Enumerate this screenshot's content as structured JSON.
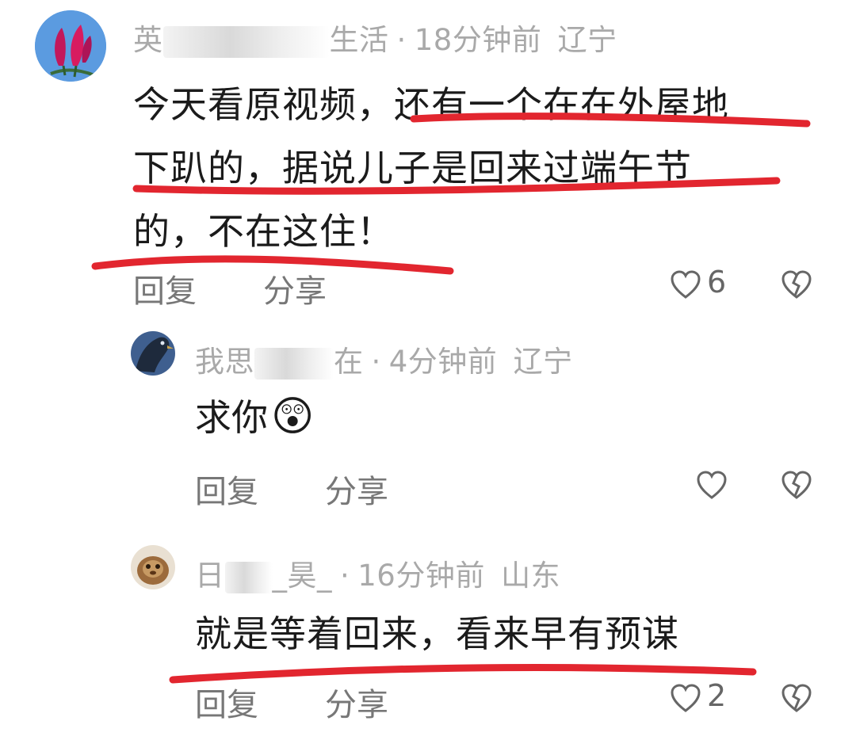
{
  "colors": {
    "underline": "#e2262f",
    "meta": "#a9a9a9",
    "text": "#1b1b1b",
    "action": "#777777"
  },
  "comments": [
    {
      "user_visible_start": "英",
      "user_visible_end": "生活",
      "separator": "·",
      "time": "18分钟前",
      "location": "辽宁",
      "text_lines": [
        "今天看原视频，还有一个在在外屋地",
        "下趴的，据说儿子是回来过端午节",
        "的，不在这住！"
      ],
      "reply_label": "回复",
      "share_label": "分享",
      "like_icon": "heart-outline-icon",
      "like_count": "6",
      "dislike_icon": "broken-heart-icon",
      "avatar_icon": "magnolia-flower-avatar"
    },
    {
      "user_visible_start": "我思",
      "user_visible_end": "在",
      "separator": "·",
      "time": "4分钟前",
      "location": "辽宁",
      "text": "求你",
      "emoji": "😲",
      "reply_label": "回复",
      "share_label": "分享",
      "like_icon": "heart-outline-icon",
      "dislike_icon": "broken-heart-icon",
      "avatar_icon": "dark-bird-avatar"
    },
    {
      "user_visible_start": "日",
      "user_visible_end": "_昊_",
      "separator": "·",
      "time": "16分钟前",
      "location": "山东",
      "text": "就是等着回来，看来早有预谋",
      "reply_label": "回复",
      "share_label": "分享",
      "like_icon": "heart-outline-icon",
      "like_count": "2",
      "dislike_icon": "broken-heart-icon",
      "avatar_icon": "brown-creature-avatar"
    }
  ]
}
